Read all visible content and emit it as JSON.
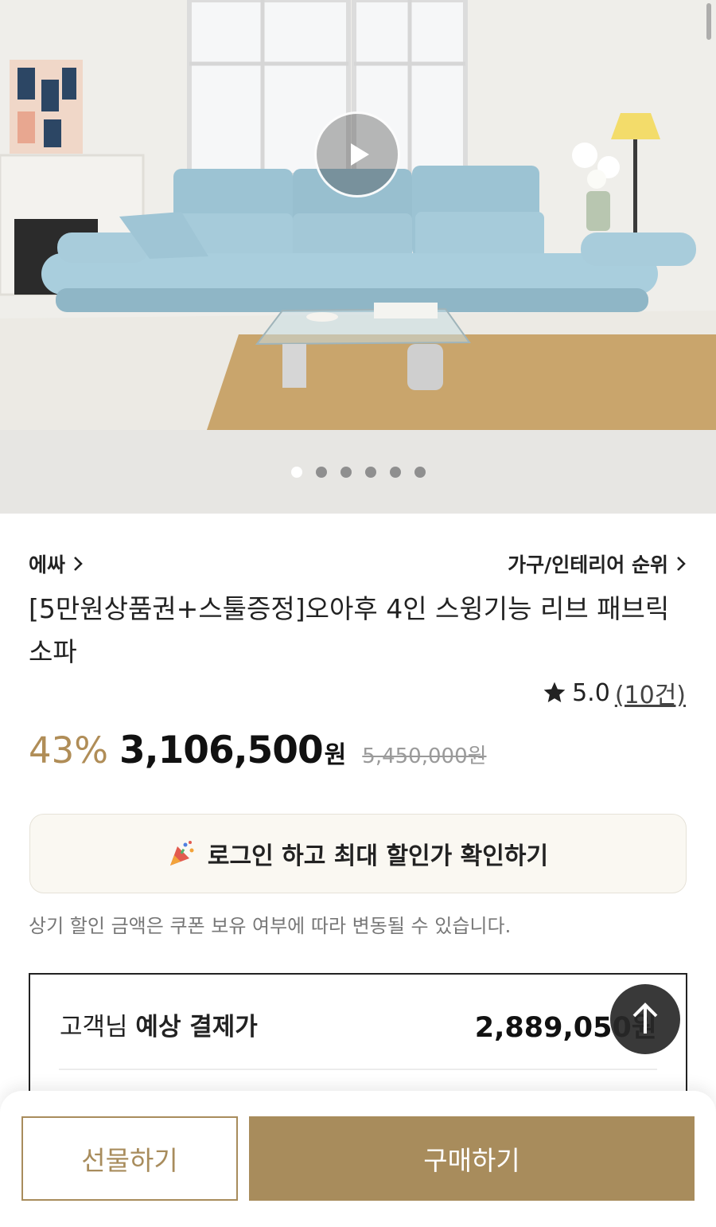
{
  "gallery": {
    "slide_count": 6,
    "active_index": 0
  },
  "product": {
    "brand": "에싸",
    "ranking_link": "가구/인테리어 순위",
    "title": "[5만원상품권+스툴증정]오아후 4인 스윙기능 리브 패브릭 소파",
    "rating": "5.0",
    "review_count": "(10건)",
    "discount": "43%",
    "price": "3,106,500",
    "currency": "원",
    "original_price": "5,450,000원"
  },
  "login_banner": {
    "text": "로그인 하고 최대 할인가 확인하기"
  },
  "discount_note": "상기 할인 금액은 쿠폰 보유 여부에 따라 변동될 수 있습니다.",
  "estimate": {
    "label_prefix": "고객님",
    "label_bold": "예상 결제가",
    "amount": "2,889,050원"
  },
  "actions": {
    "gift_label": "선물하기",
    "buy_label": "구매하기"
  },
  "colors": {
    "accent": "#a88c5c",
    "discount": "#b08d57"
  },
  "icons": [
    "play-icon",
    "chevron-right-icon",
    "star-icon",
    "party-popper-icon",
    "arrow-up-icon"
  ]
}
